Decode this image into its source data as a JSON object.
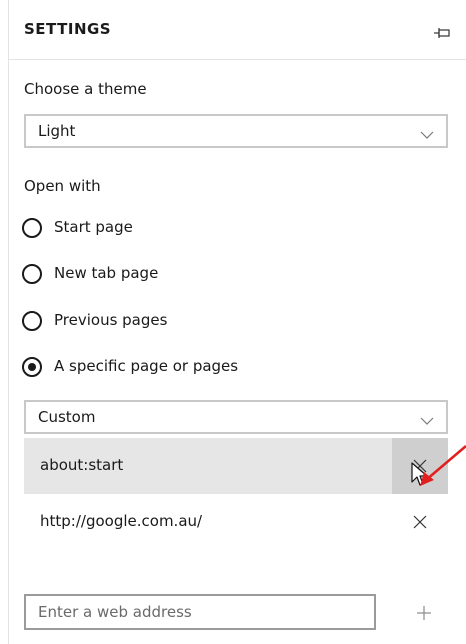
{
  "header": {
    "title": "SETTINGS",
    "pin_icon": "pin-icon"
  },
  "theme": {
    "label": "Choose a theme",
    "selected": "Light",
    "chevron_icon": "chevron-down-icon"
  },
  "open_with": {
    "label": "Open with",
    "options": [
      {
        "label": "Start page",
        "selected": false
      },
      {
        "label": "New tab page",
        "selected": false
      },
      {
        "label": "Previous pages",
        "selected": false
      },
      {
        "label": "A specific page or pages",
        "selected": true
      }
    ],
    "page_set": {
      "selected": "Custom",
      "chevron_icon": "chevron-down-icon"
    }
  },
  "pages": [
    {
      "url": "about:start",
      "hovered": true,
      "remove_icon": "close-icon"
    },
    {
      "url": "http://google.com.au/",
      "hovered": false,
      "remove_icon": "close-icon"
    }
  ],
  "add_page": {
    "placeholder": "Enter a web address",
    "value": "",
    "add_icon": "plus-icon"
  },
  "colors": {
    "hover_row": "#e6e6e6",
    "hover_button": "#cfcfcf",
    "annotation_arrow": "#e02020"
  }
}
